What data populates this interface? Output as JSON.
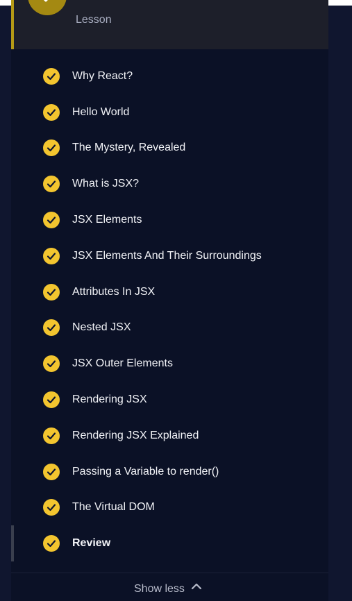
{
  "lesson_header": {
    "label": "Lesson",
    "icon": "checkmark-icon"
  },
  "lessons": [
    {
      "title": "Why React?",
      "status": "completed",
      "icon": "check-circle-icon"
    },
    {
      "title": "Hello World",
      "status": "completed",
      "icon": "check-circle-icon"
    },
    {
      "title": "The Mystery, Revealed",
      "status": "completed",
      "icon": "check-circle-icon"
    },
    {
      "title": "What is JSX?",
      "status": "completed",
      "icon": "check-circle-icon"
    },
    {
      "title": "JSX Elements",
      "status": "completed",
      "icon": "check-circle-icon"
    },
    {
      "title": "JSX Elements And Their Surroundings",
      "status": "completed",
      "icon": "check-circle-icon"
    },
    {
      "title": "Attributes In JSX",
      "status": "completed",
      "icon": "check-circle-icon"
    },
    {
      "title": "Nested JSX",
      "status": "completed",
      "icon": "check-circle-icon"
    },
    {
      "title": "JSX Outer Elements",
      "status": "completed",
      "icon": "check-circle-icon"
    },
    {
      "title": "Rendering JSX",
      "status": "completed",
      "icon": "check-circle-icon"
    },
    {
      "title": "Rendering JSX Explained",
      "status": "completed",
      "icon": "check-circle-icon"
    },
    {
      "title": "Passing a Variable to render()",
      "status": "completed",
      "icon": "check-circle-icon"
    },
    {
      "title": "The Virtual DOM",
      "status": "completed",
      "icon": "check-circle-icon"
    },
    {
      "title": "Review",
      "status": "completed",
      "icon": "check-circle-icon",
      "active": true
    }
  ],
  "footer": {
    "show_less_label": "Show less",
    "icon": "chevron-up-icon"
  },
  "colors": {
    "background": "#10162f",
    "panel": "#0b1126",
    "accent": "#f3c52f",
    "header_accent": "#b59a16",
    "text": "#f2f3f7",
    "muted_text": "#b8bccb"
  }
}
